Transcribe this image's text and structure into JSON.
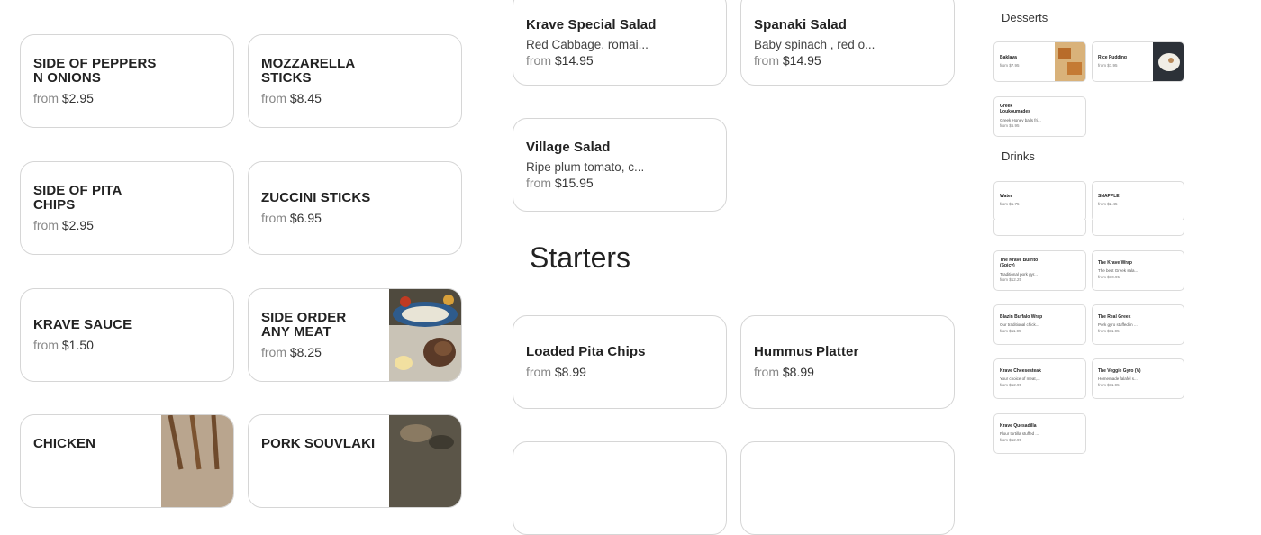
{
  "left_items": [
    {
      "name": "SIDE OF PEPPERS N ONIONS",
      "from": "from",
      "price": "$2.95"
    },
    {
      "name": "MOZZARELLA STICKS",
      "from": "from",
      "price": "$8.45"
    },
    {
      "name": "SIDE OF PITA CHIPS",
      "from": "from",
      "price": "$2.95"
    },
    {
      "name": "ZUCCINI STICKS",
      "from": "from",
      "price": "$6.95"
    },
    {
      "name": "KRAVE SAUCE",
      "from": "from",
      "price": "$1.50"
    },
    {
      "name": "SIDE ORDER ANY MEAT",
      "from": "from",
      "price": "$8.25"
    },
    {
      "name": "CHICKEN"
    },
    {
      "name": "PORK SOUVLAKI"
    }
  ],
  "salads": [
    {
      "name": "Krave Special Salad",
      "desc": "Red Cabbage, romai...",
      "from": "from",
      "price": "$14.95"
    },
    {
      "name": "Spanaki Salad",
      "desc": "Baby spinach , red o...",
      "from": "from",
      "price": "$14.95"
    },
    {
      "name": "Village Salad",
      "desc": "Ripe plum tomato, c...",
      "from": "from",
      "price": "$15.95"
    }
  ],
  "starters_title": "Starters",
  "starters": [
    {
      "name": "Loaded Pita Chips",
      "from": "from",
      "price": "$8.99"
    },
    {
      "name": "Hummus Platter",
      "from": "from",
      "price": "$8.99"
    }
  ],
  "minimap": {
    "desserts_title": "Desserts",
    "drinks_title": "Drinks",
    "desserts": [
      {
        "name": "Baklava",
        "price": "from $7.95"
      },
      {
        "name": "Rice Pudding",
        "price": "from $7.95"
      },
      {
        "name": "Greek Loukoumades",
        "desc": "Greek Honey balls fri...",
        "price": "from $6.95"
      }
    ],
    "drinks": [
      {
        "name": "Water",
        "price": "from $1.75"
      },
      {
        "name": "SNAPPLE",
        "price": "from $2.45"
      }
    ],
    "wraps": [
      {
        "name": "The Krave Burrito (Spicy)",
        "desc": "Traditional pork gyr...",
        "price": "from $12.25"
      },
      {
        "name": "The Krave Wrap",
        "desc": "The best Greek sala...",
        "price": "from $10.95"
      },
      {
        "name": "Blazin Buffalo Wrap",
        "desc": "Our traditional chick...",
        "price": "from $11.95"
      },
      {
        "name": "The Real Greek",
        "desc": "Pork gyro stuffed in ...",
        "price": "from $11.95"
      },
      {
        "name": "Krave Cheesesteak",
        "desc": "Your choice of meat,...",
        "price": "from $12.95"
      },
      {
        "name": "The Veggie Gyro (V)",
        "desc": "Homemade falafel s...",
        "price": "from $11.95"
      },
      {
        "name": "Krave Quesadilla",
        "desc": "Flour tortilla stuffed ...",
        "price": "from $12.95"
      }
    ]
  },
  "colors": {
    "border": "#d6d6d6",
    "text": "#222222",
    "muted": "#888888"
  }
}
